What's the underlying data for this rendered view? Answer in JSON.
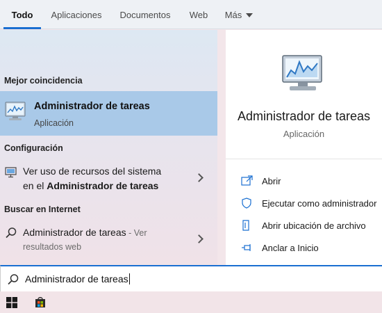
{
  "tabs": [
    {
      "label": "Todo",
      "active": true
    },
    {
      "label": "Aplicaciones",
      "active": false
    },
    {
      "label": "Documentos",
      "active": false
    },
    {
      "label": "Web",
      "active": false
    },
    {
      "label": "Más",
      "active": false
    }
  ],
  "sections": {
    "best_match": "Mejor coincidencia",
    "settings": "Configuración",
    "web": "Buscar en Internet"
  },
  "best_match": {
    "title": "Administrador de tareas",
    "subtitle": "Aplicación",
    "icon": "task-manager-icon"
  },
  "settings_result": {
    "line1": "Ver uso de recursos del sistema",
    "line2_prefix": "en el ",
    "line2_bold": "Administrador de tareas",
    "icon": "monitor-settings-icon"
  },
  "web_result": {
    "title": "Administrador de tareas",
    "suffix": " - Ver",
    "line2": "resultados web",
    "icon": "search-icon"
  },
  "preview": {
    "title": "Administrador de tareas",
    "type": "Aplicación",
    "actions": [
      {
        "label": "Abrir",
        "icon": "open-icon"
      },
      {
        "label": "Ejecutar como administrador",
        "icon": "shield-icon"
      },
      {
        "label": "Abrir ubicación de archivo",
        "icon": "file-location-icon"
      },
      {
        "label": "Anclar a Inicio",
        "icon": "pin-icon"
      }
    ]
  },
  "search": {
    "value": "Administrador de tareas"
  },
  "taskbar": {
    "items": [
      "windows-start-icon",
      "store-icon"
    ]
  },
  "colors": {
    "accent": "#1a6fd1",
    "selected_row": "#a9c9e8"
  }
}
